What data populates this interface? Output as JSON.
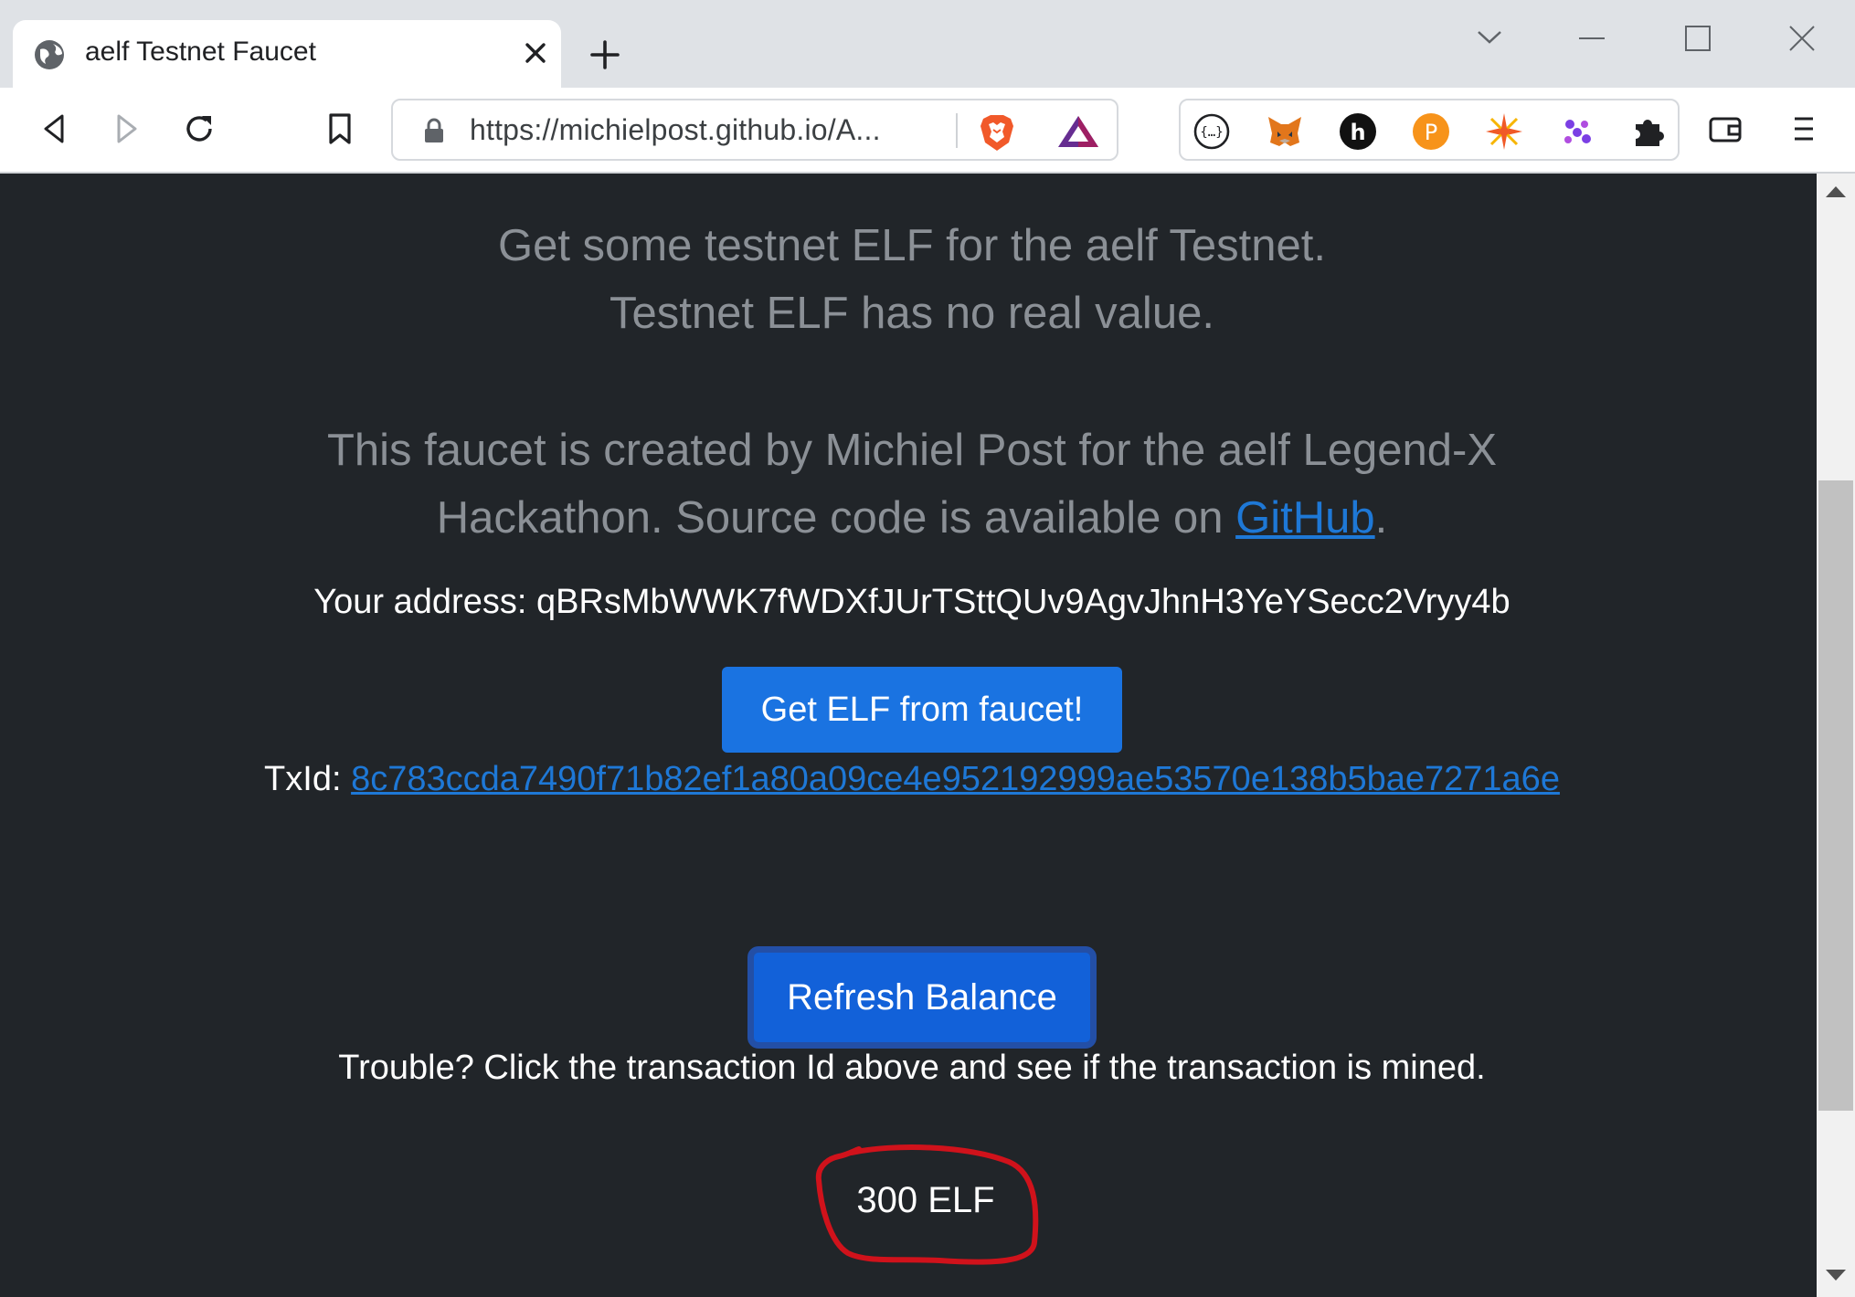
{
  "browser": {
    "tab_title": "aelf Testnet Faucet",
    "url": "https://michielpost.github.io/A...",
    "icons": {
      "tab_favicon": "globe-icon",
      "tab_close": "close-icon",
      "new_tab": "plus-icon",
      "tab_search": "chevron-down-icon",
      "minimize": "minimize-icon",
      "maximize": "maximize-icon",
      "close_window": "close-icon",
      "back": "back-icon",
      "forward": "forward-icon",
      "reload": "reload-icon",
      "bookmark": "bookmark-icon",
      "lock": "lock-icon",
      "brave_shields": "brave-lion-icon",
      "brave_rewards": "brave-rewards-icon",
      "extensions_menu": "puzzle-icon",
      "wallet": "wallet-icon",
      "menu": "hamburger-menu-icon"
    },
    "extensions": [
      "json-viewer-icon",
      "metamask-fox-icon",
      "hive-icon",
      "pay-icon",
      "spark-icon",
      "dots-cluster-icon"
    ]
  },
  "page": {
    "intro_line1": "Get some testnet ELF for the aelf Testnet.",
    "intro_line2": "Testnet ELF has no real value.",
    "credit_line1": "This faucet is created by Michiel Post for the aelf Legend-X",
    "credit_line2_prefix": "Hackathon. Source code is available on ",
    "credit_link": "GitHub",
    "credit_line2_suffix": ".",
    "address_label": "Your address: ",
    "address": "qBRsMbWWK7fWDXfJUrTSttQUv9AgvJhnH3YeYSecc2Vryy4b",
    "faucet_button": "Get ELF from faucet!",
    "txid_label": "TxId: ",
    "txid": "8c783ccda7490f71b82ef1a80a09ce4e952192999ae53570e138b5bae7271a6e",
    "refresh_button": "Refresh Balance",
    "trouble_text": "Trouble? Click the transaction Id above and see if the transaction is mined.",
    "balance": "300 ELF"
  },
  "colors": {
    "page_bg": "#212529",
    "muted_text": "#8b9096",
    "link": "#1e78d6",
    "primary_button": "#1a73e1",
    "annotation": "#d0121b"
  }
}
